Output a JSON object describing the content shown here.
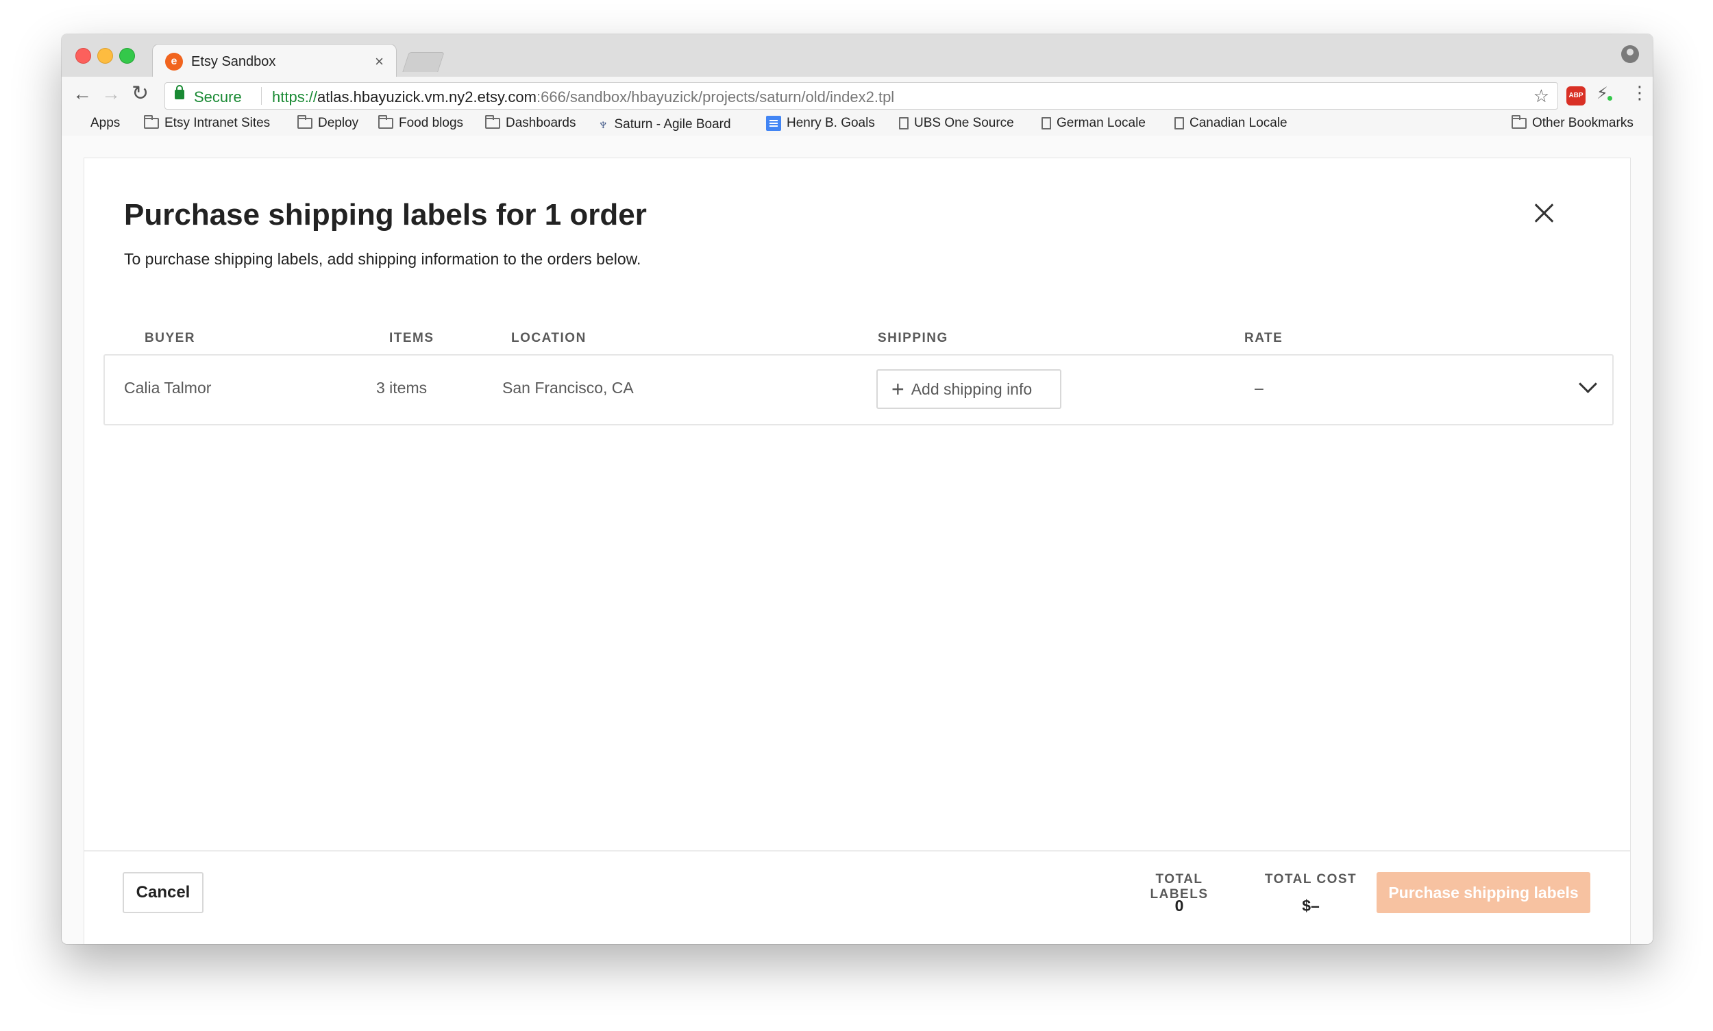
{
  "browser": {
    "tab_title": "Etsy Sandbox",
    "tab_favicon": "etsy-favicon",
    "tab_close": "×",
    "secure_label": "Secure",
    "url_scheme": "https://",
    "url_host": "atlas.hbayuzick.vm.ny2.etsy.com",
    "url_rest": ":666/sandbox/hbayuzick/projects/saturn/old/index2.tpl",
    "abp_label": "ABP"
  },
  "bookmarks": [
    {
      "label": "Apps",
      "icon": "apps-grid-icon"
    },
    {
      "label": "Etsy Intranet Sites",
      "icon": "folder-icon"
    },
    {
      "label": "Deploy",
      "icon": "folder-icon"
    },
    {
      "label": "Food blogs",
      "icon": "folder-icon"
    },
    {
      "label": "Dashboards",
      "icon": "folder-icon"
    },
    {
      "label": "Saturn - Agile Board",
      "icon": "saturn-icon"
    },
    {
      "label": "Henry B. Goals",
      "icon": "doc-icon"
    },
    {
      "label": "UBS One Source",
      "icon": "page-icon"
    },
    {
      "label": "German Locale",
      "icon": "page-icon"
    },
    {
      "label": "Canadian Locale",
      "icon": "page-icon"
    }
  ],
  "other_bookmarks": "Other Bookmarks",
  "modal": {
    "title": "Purchase shipping labels for 1 order",
    "subtitle": "To purchase shipping labels, add shipping information to the orders below.",
    "columns": {
      "buyer": "BUYER",
      "items": "ITEMS",
      "location": "LOCATION",
      "shipping": "SHIPPING",
      "rate": "RATE"
    },
    "orders": [
      {
        "buyer": "Calia Talmor",
        "items": "3 items",
        "location": "San Francisco, CA",
        "shipping_button": "Add shipping info",
        "rate": "–"
      }
    ],
    "footer": {
      "cancel": "Cancel",
      "total_labels_label": "TOTAL LABELS",
      "total_labels_value": "0",
      "total_cost_label": "TOTAL COST",
      "total_cost_value": "$–",
      "purchase": "Purchase shipping labels"
    }
  },
  "colors": {
    "brand_orange": "#f1641e",
    "purchase_disabled": "#f7c2a1",
    "secure_green": "#1a8a34"
  }
}
